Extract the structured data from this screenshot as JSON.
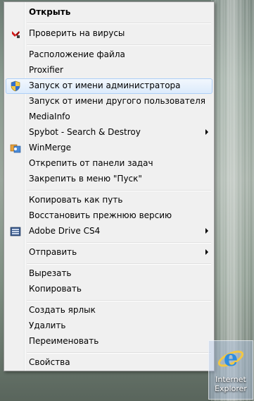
{
  "menu": {
    "items": [
      {
        "label": "Открыть"
      },
      {
        "label": "Проверить на вирусы"
      },
      {
        "label": "Расположение файла"
      },
      {
        "label": "Proxifier"
      },
      {
        "label": "Запуск от имени администратора"
      },
      {
        "label": "Запуск от имени другого пользователя"
      },
      {
        "label": "MediaInfo"
      },
      {
        "label": "Spybot - Search & Destroy"
      },
      {
        "label": "WinMerge"
      },
      {
        "label": "Открепить от панели задач"
      },
      {
        "label": "Закрепить в меню \"Пуск\""
      },
      {
        "label": "Копировать как путь"
      },
      {
        "label": "Восстановить прежнюю версию"
      },
      {
        "label": "Adobe Drive CS4"
      },
      {
        "label": "Отправить"
      },
      {
        "label": "Вырезать"
      },
      {
        "label": "Копировать"
      },
      {
        "label": "Создать ярлык"
      },
      {
        "label": "Удалить"
      },
      {
        "label": "Переименовать"
      },
      {
        "label": "Свойства"
      }
    ]
  },
  "desktop": {
    "icon_label_line1": "Internet",
    "icon_label_line2": "Explorer",
    "icon": "internet-explorer-icon"
  }
}
